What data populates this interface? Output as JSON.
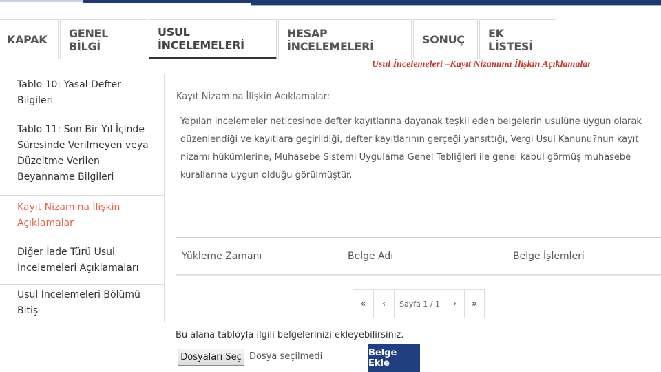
{
  "tabs": [
    {
      "label": "KAPAK",
      "active": false
    },
    {
      "label": "GENEL BİLGİ",
      "active": false
    },
    {
      "label": "USUL İNCELEMELERİ",
      "active": true
    },
    {
      "label": "HESAP İNCELEMELERİ",
      "active": false
    },
    {
      "label": "SONUÇ",
      "active": false
    },
    {
      "label": "EK LİSTESİ",
      "active": false
    }
  ],
  "subtitle": "Usul İncelemeleri –Kayıt Nizamına İlişkin Açıklamalar",
  "sidebar": {
    "items": [
      {
        "label": "Tablo 10: Yasal Defter Bilgileri",
        "active": false
      },
      {
        "label": "Tablo 11: Son Bir Yıl İçinde Süresinde Verilmeyen veya Düzeltme Verilen Beyanname Bilgileri",
        "active": false
      },
      {
        "label": "Kayıt Nizamına İlişkin Açıklamalar",
        "active": true
      },
      {
        "label": "Diğer İade Türü Usul İncelemeleri Açıklamaları",
        "active": false
      },
      {
        "label": "Usul İncelemeleri Bölümü Bitiş",
        "active": false
      }
    ]
  },
  "description": {
    "label": "Kayıt Nizamına İlişkin Açıklamalar:",
    "text": "Yapılan incelemeler neticesinde defter kayıtlarına dayanak teşkil eden belgelerin usulüne uygun olarak düzenlendiği ve kayıtlara geçirildiği, defter kayıtlarının gerçeği yansıttığı, Vergi Usul Kanunu?nun kayıt nizamı hükümlerine, Muhasebe Sistemi Uygulama Genel Tebliğleri ile genel kabul görmüş muhasebe kurallarına uygun olduğu görülmüştür."
  },
  "table": {
    "columns": [
      "Yükleme Zamanı",
      "Belge Adı",
      "Belge İşlemleri"
    ]
  },
  "pager": {
    "first": "«",
    "prev": "‹",
    "info": "Sayfa 1 / 1",
    "next": "›",
    "last": "»"
  },
  "upload": {
    "hint": "Bu alana tabloyla ilgili belgelerinizi ekleyebilirsiniz.",
    "file_button": "Dosyaları Seç",
    "file_status": "Dosya seçilmedi",
    "add_button": "Belge Ekle"
  },
  "colors": {
    "brand": "#1f3a6e",
    "active_item": "#e0644f",
    "subtitle": "#c0392b"
  }
}
